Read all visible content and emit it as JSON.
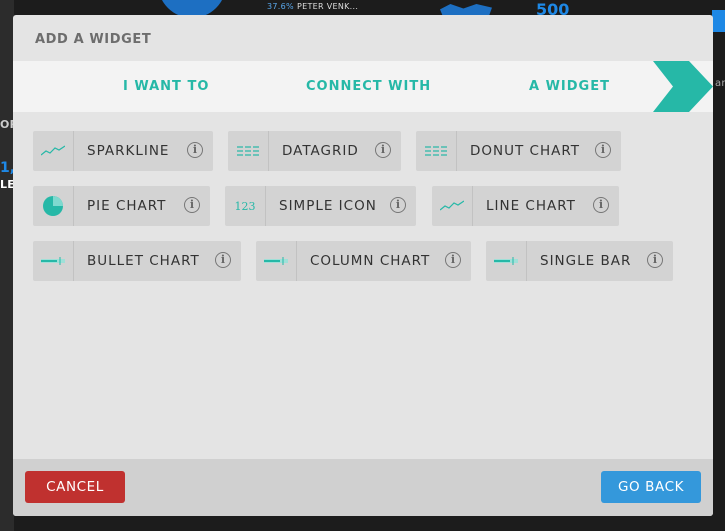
{
  "background": {
    "person_pct": "37.6%",
    "person_name": "PETER VENK...",
    "big_number": "500",
    "left_number": "1,",
    "left_label_top": "OR",
    "left_label_bottom": "LE",
    "right_edge_text": "am"
  },
  "modal": {
    "title": "ADD A WIDGET",
    "steps": [
      "I WANT TO",
      "CONNECT WITH",
      "A WIDGET"
    ],
    "widgets": [
      {
        "label": "SPARKLINE",
        "icon": "sparkline-icon"
      },
      {
        "label": "DATAGRID",
        "icon": "datagrid-icon"
      },
      {
        "label": "DONUT CHART",
        "icon": "donut-chart-icon"
      },
      {
        "label": "PIE CHART",
        "icon": "pie-chart-icon"
      },
      {
        "label": "SIMPLE ICON",
        "icon": "simple-icon-icon",
        "glyph": "123"
      },
      {
        "label": "LINE CHART",
        "icon": "line-chart-icon"
      },
      {
        "label": "BULLET CHART",
        "icon": "bullet-chart-icon"
      },
      {
        "label": "COLUMN CHART",
        "icon": "column-chart-icon"
      },
      {
        "label": "SINGLE BAR",
        "icon": "single-bar-icon"
      }
    ],
    "info_glyph": "i",
    "cancel_label": "CANCEL",
    "back_label": "GO BACK"
  },
  "colors": {
    "accent": "#26b8a7",
    "cancel": "#c0312f",
    "back": "#3498db"
  }
}
